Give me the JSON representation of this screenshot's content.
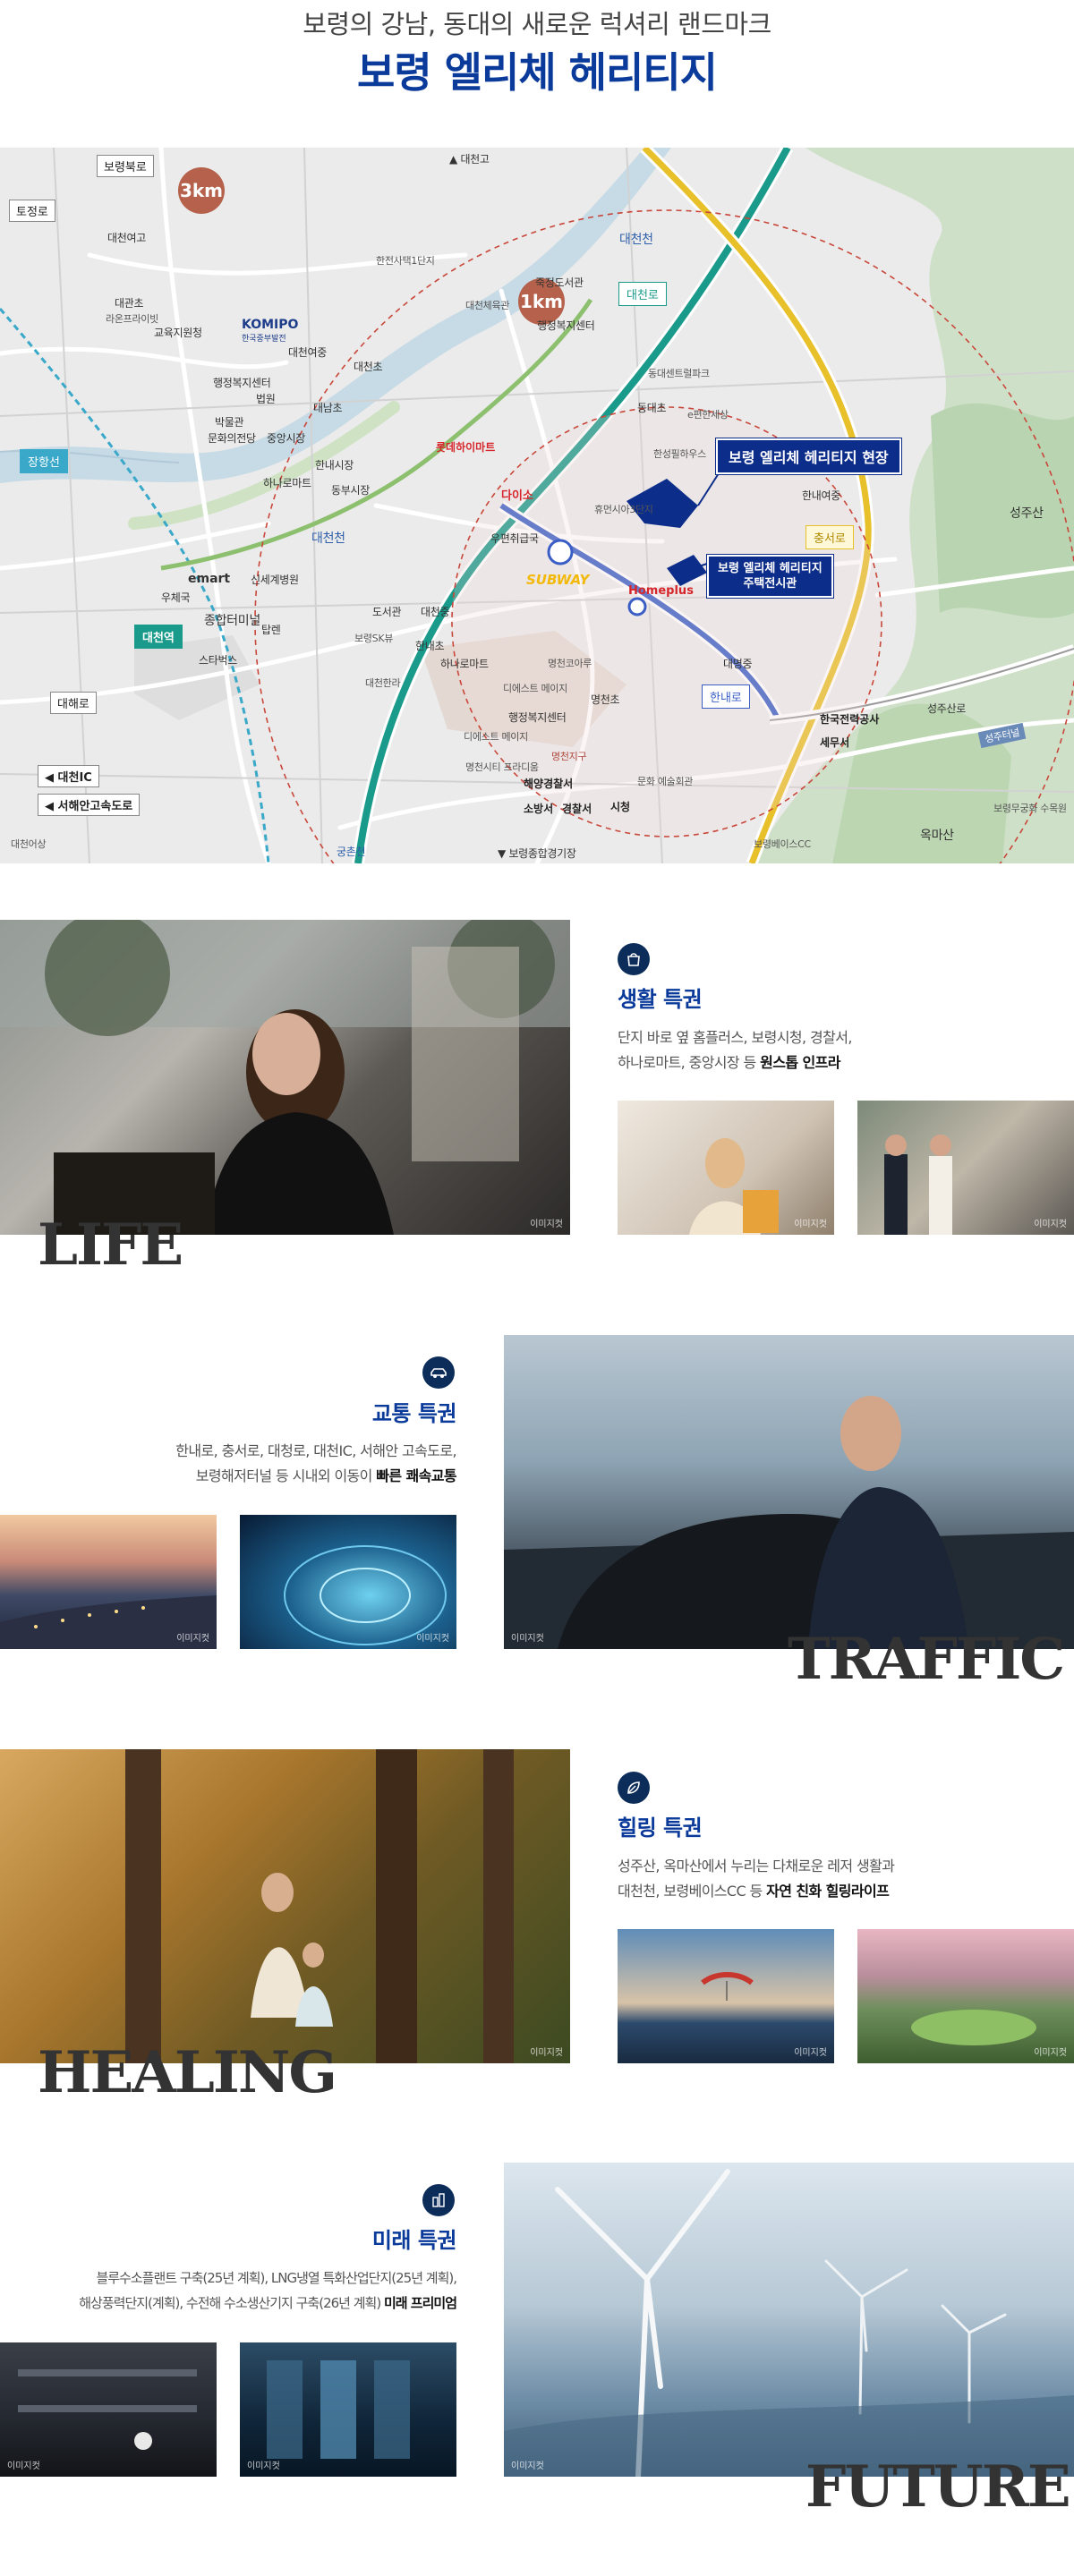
{
  "header": {
    "subtitle": "보령의 강남, 동대의 새로운 럭셔리 랜드마크",
    "title": "보령 엘리체 헤리티지"
  },
  "map": {
    "radius_labels": [
      "3km",
      "1km"
    ],
    "callouts": {
      "site": "보령 엘리체 헤리티지 현장",
      "house_line1": "보령 엘리체 헤리티지",
      "house_line2": "주택전시관"
    },
    "roads": [
      "대천로",
      "충서로",
      "한내로",
      "장항선",
      "성주산로",
      "성주터널"
    ],
    "boxes": [
      "보령북로",
      "토정로",
      "대해로",
      "◀ 대천IC",
      "◀ 서해안고속도로"
    ],
    "stations": [
      "대천역"
    ],
    "brands": [
      "KOMIPO",
      "한국중부발전",
      "롯데하이마트",
      "다이소",
      "SUBWAY",
      "Homeplus",
      "emart",
      "한국전력공사",
      "세무서",
      "해양경찰서",
      "소방서",
      "경찰서",
      "시청"
    ],
    "places": [
      {
        "t": "▲ 대천고"
      },
      {
        "t": "대천여고"
      },
      {
        "t": "대관초"
      },
      {
        "t": "라온프라이빗"
      },
      {
        "t": "교육지원청"
      },
      {
        "t": "대천여중"
      },
      {
        "t": "대천초"
      },
      {
        "t": "행정복지센터"
      },
      {
        "t": "법원"
      },
      {
        "t": "대남초"
      },
      {
        "t": "박물관"
      },
      {
        "t": "문화의전당"
      },
      {
        "t": "중앙시장"
      },
      {
        "t": "한내시장"
      },
      {
        "t": "하나로마트"
      },
      {
        "t": "동부시장"
      },
      {
        "t": "한전사택1단지"
      },
      {
        "t": "대천체육관"
      },
      {
        "t": "죽정도서관"
      },
      {
        "t": "행정복지센터"
      },
      {
        "t": "대천천"
      },
      {
        "t": "동대센트럴파크"
      },
      {
        "t": "동대초"
      },
      {
        "t": "e편한세상"
      },
      {
        "t": "한성필하우스"
      },
      {
        "t": "휴먼시아3단지"
      },
      {
        "t": "한내여중"
      },
      {
        "t": "우편취급국"
      },
      {
        "t": "우체국"
      },
      {
        "t": "신세계병원"
      },
      {
        "t": "종합터미널"
      },
      {
        "t": "탑렌"
      },
      {
        "t": "스타벅스"
      },
      {
        "t": "도서관"
      },
      {
        "t": "대천중"
      },
      {
        "t": "보령SK뷰"
      },
      {
        "t": "한내초"
      },
      {
        "t": "대천천"
      },
      {
        "t": "대천한라"
      },
      {
        "t": "하나로마트"
      },
      {
        "t": "명천코아루"
      },
      {
        "t": "대명중"
      },
      {
        "t": "디에스트 메이지"
      },
      {
        "t": "명천초"
      },
      {
        "t": "행정복지센터"
      },
      {
        "t": "명천지구"
      },
      {
        "t": "디에스트 메이지"
      },
      {
        "t": "명천시티 프라디움"
      },
      {
        "t": "문화 예술회관"
      },
      {
        "t": "성주산"
      },
      {
        "t": "옥마산"
      },
      {
        "t": "보령무궁화 수목원"
      },
      {
        "t": "보령베이스CC"
      },
      {
        "t": "▼ 보령종합경기장"
      },
      {
        "t": "궁촌천"
      },
      {
        "t": "대천어상"
      }
    ]
  },
  "sections": {
    "life": {
      "word": "LIFE",
      "title": "생활 특권",
      "desc_line1": "단지 바로 옆 홈플러스, 보령시청, 경찰서,",
      "desc_line2_pre": "하나로마트, 중앙시장 등 ",
      "desc_line2_bold": "원스톱 인프라",
      "caption": "이미지컷"
    },
    "traffic": {
      "word": "TRAFFIC",
      "title": "교통 특권",
      "desc_line1": "한내로, 충서로, 대청로, 대천IC, 서해안 고속도로,",
      "desc_line2_pre": "보령해저터널 등 시내외 이동이 ",
      "desc_line2_bold": "빠른 쾌속교통",
      "caption": "이미지컷"
    },
    "healing": {
      "word": "HEALING",
      "title": "힐링 특권",
      "desc_line1": "성주산, 옥마산에서 누리는 다채로운 레저 생활과",
      "desc_line2_pre": "대천천, 보령베이스CC 등 ",
      "desc_line2_bold": "자연 친화 힐링라이프",
      "caption": "이미지컷"
    },
    "future": {
      "word": "FUTURE",
      "title": "미래 특권",
      "desc_line1": "블루수소플랜트 구축(25년 계획), LNG냉열 특화산업단지(25년 계획),",
      "desc_line2_pre": "해상풍력단지(계획), 수전해 수소생산기지 구축(26년 계획) ",
      "desc_line2_bold": "미래 프리미엄",
      "caption": "이미지컷"
    }
  },
  "colors": {
    "brand_navy": "#0a3a9a",
    "callout": "#0c2d8a",
    "road_teal": "#1a9a8a",
    "road_yellow": "#e8c12a",
    "radius": "#c9473a",
    "rail": "#3aa8c8"
  },
  "icons": {
    "life": "shopping-icon",
    "traffic": "car-icon",
    "healing": "leaf-icon",
    "future": "building-icon"
  }
}
